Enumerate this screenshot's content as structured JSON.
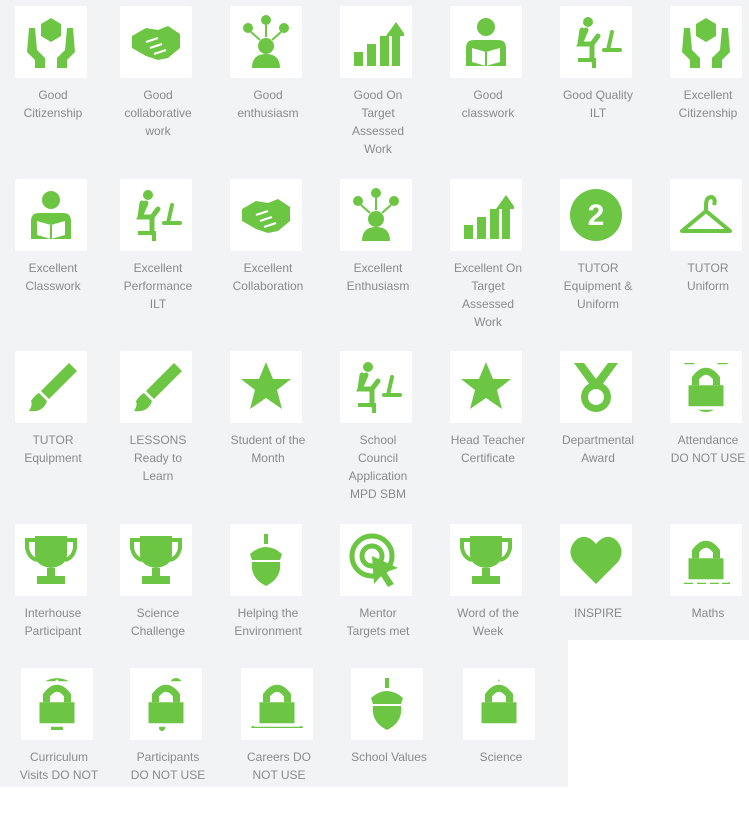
{
  "accent_color": "#6cc644",
  "badges": [
    {
      "label": "Good\nCitizenship",
      "icon": "hands-hexagon-icon"
    },
    {
      "label": "Good\ncollaborative\nwork",
      "icon": "handshake-icon"
    },
    {
      "label": "Good\nenthusiasm",
      "icon": "enthusiasm-person-icon"
    },
    {
      "label": "Good On\nTarget\nAssessed\nWork",
      "icon": "growth-chart-icon"
    },
    {
      "label": "Good\nclasswork",
      "icon": "reading-person-icon"
    },
    {
      "label": "Good Quality\nILT",
      "icon": "person-at-computer-icon"
    },
    {
      "label": "Excellent\nCitizenship",
      "icon": "hands-hexagon-icon"
    },
    {
      "label": "Excellent\nClasswork",
      "icon": "reading-person-icon"
    },
    {
      "label": "Excellent\nPerformance\nILT",
      "icon": "person-at-computer-icon"
    },
    {
      "label": "Excellent\nCollaboration",
      "icon": "handshake-icon"
    },
    {
      "label": "Excellent\nEnthusiasm",
      "icon": "enthusiasm-person-icon"
    },
    {
      "label": "Excellent On\nTarget\nAssessed\nWork",
      "icon": "growth-chart-icon"
    },
    {
      "label": "TUTOR\nEquipment &\nUniform",
      "icon": "number-two-icon",
      "number": "2"
    },
    {
      "label": "TUTOR\nUniform",
      "icon": "hanger-icon"
    },
    {
      "label": "TUTOR\nEquipment",
      "icon": "paintbrush-icon"
    },
    {
      "label": "LESSONS\nReady to\nLearn",
      "icon": "paintbrush-icon"
    },
    {
      "label": "Student of the\nMonth",
      "icon": "star-icon"
    },
    {
      "label": "School\nCouncil\nApplication\nMPD SBM",
      "icon": "person-at-computer-icon"
    },
    {
      "label": "Head Teacher\nCertificate",
      "icon": "star-icon"
    },
    {
      "label": "Departmental\nAward",
      "icon": "medal-icon"
    },
    {
      "label": "Attendance\nDO NOT USE",
      "icon": "medal-icon",
      "locked": true
    },
    {
      "label": "Interhouse\nParticipant",
      "icon": "trophy-icon"
    },
    {
      "label": "Science\nChallenge",
      "icon": "trophy-icon"
    },
    {
      "label": "Helping the\nEnvironment",
      "icon": "acorn-icon"
    },
    {
      "label": "Mentor\nTargets met",
      "icon": "target-cursor-icon"
    },
    {
      "label": "Word of the\nWeek",
      "icon": "trophy-icon"
    },
    {
      "label": "INSPIRE",
      "icon": "heart-icon"
    },
    {
      "label": "Maths",
      "icon": "growth-chart-icon",
      "locked": true
    },
    {
      "label": "Curriculum\nVisits DO NOT",
      "icon": "hot-air-balloon-icon",
      "locked": true
    },
    {
      "label": "Participants\nDO NOT USE",
      "icon": "runner-icon",
      "locked": true
    },
    {
      "label": "Careers DO\nNOT USE",
      "icon": "mountain-icon",
      "locked": true
    },
    {
      "label": "School Values",
      "icon": "acorn-icon"
    },
    {
      "label": "Science",
      "icon": "star-icon",
      "locked": true
    }
  ]
}
